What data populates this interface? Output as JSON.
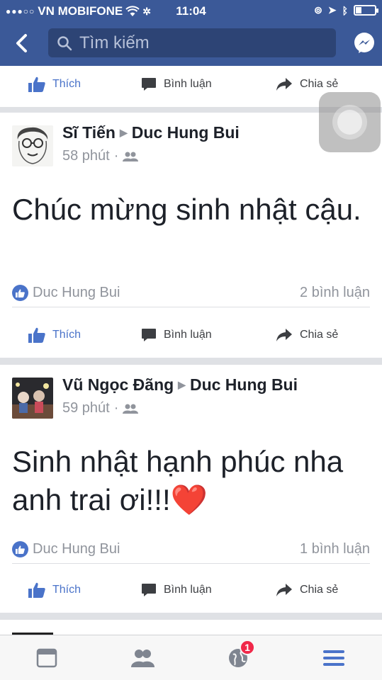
{
  "status_bar": {
    "carrier": "VN MOBIFONE",
    "time": "11:04",
    "signal_dots": "●●●○○"
  },
  "search": {
    "placeholder": "Tìm kiếm"
  },
  "actions": {
    "like": "Thích",
    "comment": "Bình luận",
    "share": "Chia sẻ"
  },
  "posts": [
    {
      "author": "Sĩ Tiến",
      "target": "Duc Hung Bui",
      "time": "58 phút",
      "text": "Chúc mừng sinh nhật cậu.",
      "likers": "Duc Hung Bui",
      "comments": "2 bình luận"
    },
    {
      "author": "Vũ Ngọc Đãng",
      "target": "Duc Hung Bui",
      "time": "59 phút",
      "text": "Sinh nhật hạnh phúc nha anh trai ơi!!!❤️",
      "likers": "Duc Hung Bui",
      "comments": "1 bình luận"
    }
  ],
  "tabbar": {
    "notifications_badge": "1"
  },
  "colors": {
    "brand": "#3b5998",
    "like_blue": "#4a73c9",
    "badge_red": "#f02849"
  }
}
